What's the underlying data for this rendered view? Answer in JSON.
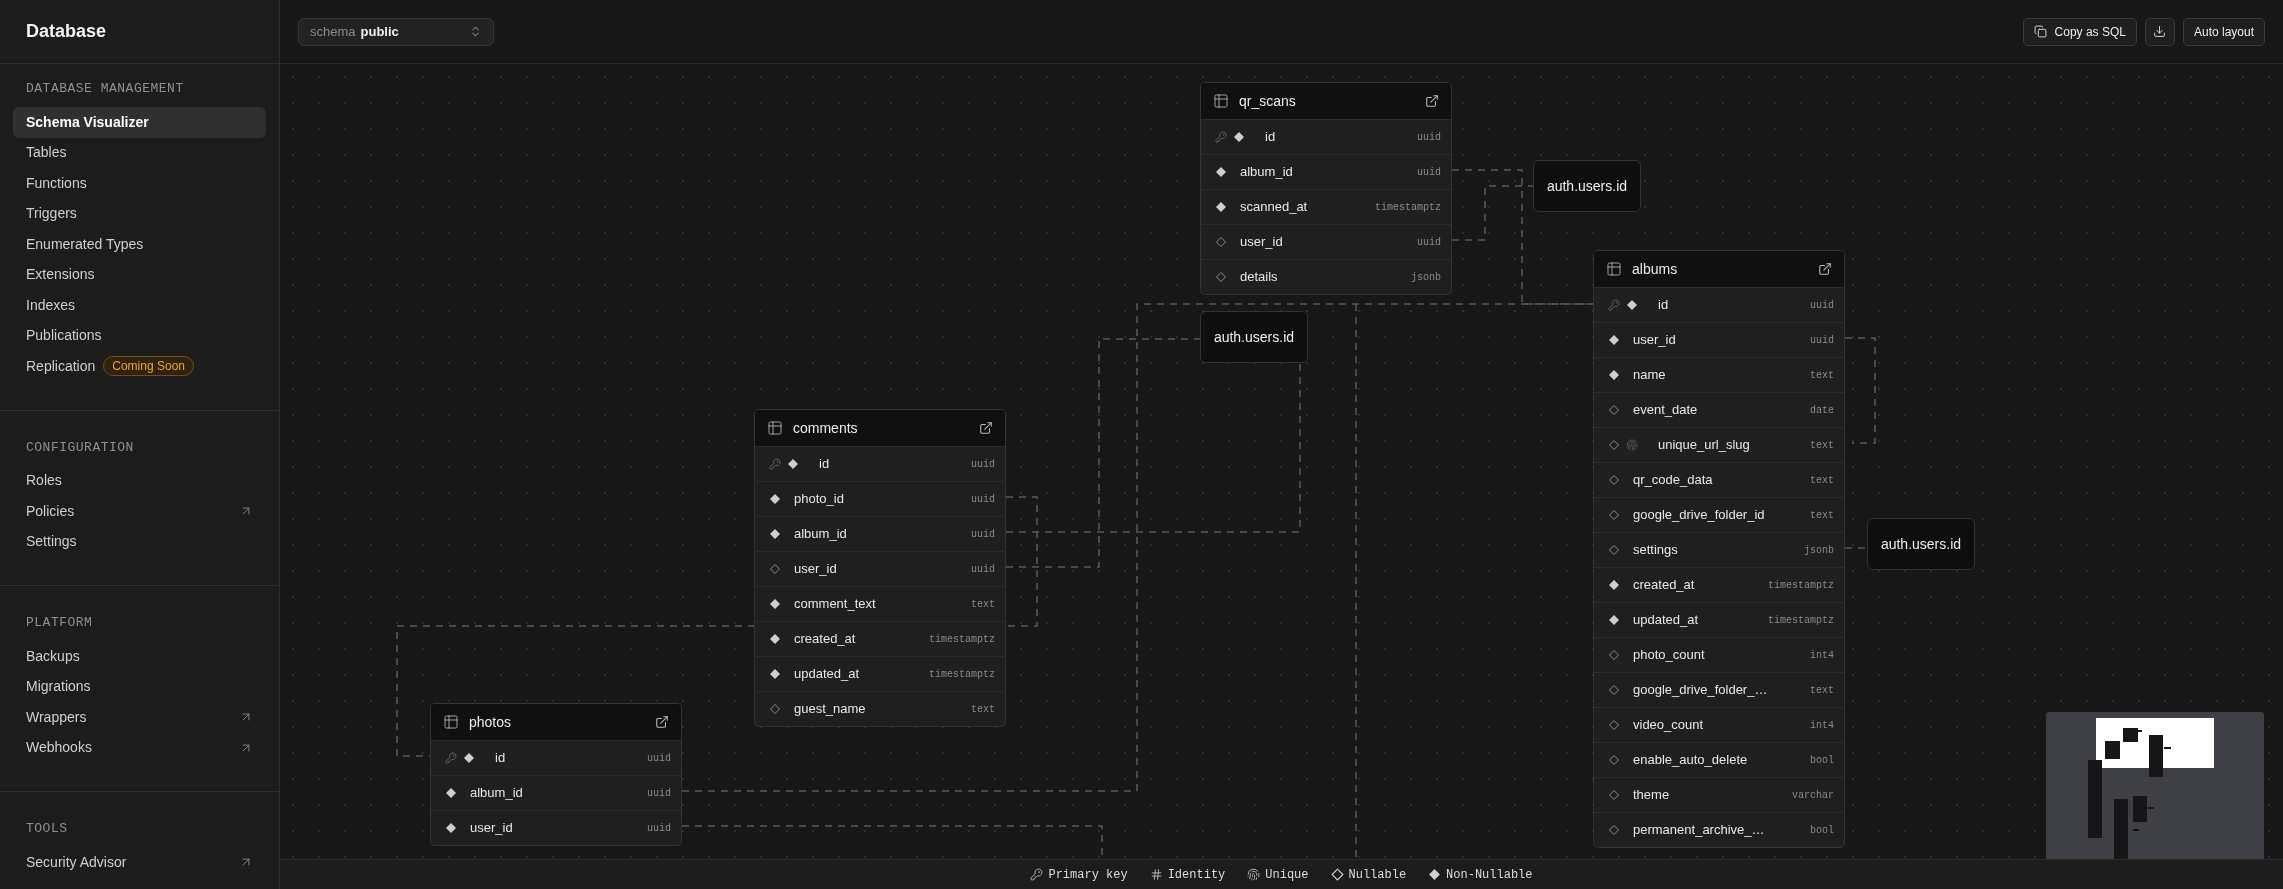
{
  "sidebar": {
    "title": "Database",
    "sections": [
      {
        "heading": "DATABASE MANAGEMENT",
        "items": [
          {
            "label": "Schema Visualizer",
            "selected": true,
            "external": false
          },
          {
            "label": "Tables",
            "selected": false,
            "external": false
          },
          {
            "label": "Functions",
            "selected": false,
            "external": false
          },
          {
            "label": "Triggers",
            "selected": false,
            "external": false
          },
          {
            "label": "Enumerated Types",
            "selected": false,
            "external": false
          },
          {
            "label": "Extensions",
            "selected": false,
            "external": false
          },
          {
            "label": "Indexes",
            "selected": false,
            "external": false
          },
          {
            "label": "Publications",
            "selected": false,
            "external": false
          },
          {
            "label": "Replication",
            "selected": false,
            "external": false,
            "badge": "Coming Soon"
          }
        ]
      },
      {
        "heading": "CONFIGURATION",
        "items": [
          {
            "label": "Roles",
            "selected": false,
            "external": false
          },
          {
            "label": "Policies",
            "selected": false,
            "external": true
          },
          {
            "label": "Settings",
            "selected": false,
            "external": false
          }
        ]
      },
      {
        "heading": "PLATFORM",
        "items": [
          {
            "label": "Backups",
            "selected": false,
            "external": false
          },
          {
            "label": "Migrations",
            "selected": false,
            "external": false
          },
          {
            "label": "Wrappers",
            "selected": false,
            "external": true
          },
          {
            "label": "Webhooks",
            "selected": false,
            "external": true
          }
        ]
      },
      {
        "heading": "TOOLS",
        "items": [
          {
            "label": "Security Advisor",
            "selected": false,
            "external": true
          }
        ]
      }
    ]
  },
  "toolbar": {
    "schema_label": "schema",
    "schema_value": "public",
    "buttons": [
      {
        "kind": "copy",
        "label": "Copy as SQL"
      },
      {
        "kind": "download"
      },
      {
        "kind": "text",
        "label": "Auto layout"
      }
    ]
  },
  "tables": [
    {
      "name": "qr_scans",
      "columns": [
        {
          "name": "id",
          "type": "uuid",
          "primary": true,
          "nullable": false,
          "unique": false
        },
        {
          "name": "album_id",
          "type": "uuid",
          "primary": false,
          "nullable": false,
          "unique": false
        },
        {
          "name": "scanned_at",
          "type": "timestamptz",
          "primary": false,
          "nullable": false,
          "unique": false
        },
        {
          "name": "user_id",
          "type": "uuid",
          "primary": false,
          "nullable": true,
          "unique": false
        },
        {
          "name": "details",
          "type": "jsonb",
          "primary": false,
          "nullable": true,
          "unique": false
        }
      ]
    },
    {
      "name": "albums",
      "columns": [
        {
          "name": "id",
          "type": "uuid",
          "primary": true,
          "nullable": false,
          "unique": false
        },
        {
          "name": "user_id",
          "type": "uuid",
          "primary": false,
          "nullable": false,
          "unique": false
        },
        {
          "name": "name",
          "type": "text",
          "primary": false,
          "nullable": false,
          "unique": false
        },
        {
          "name": "event_date",
          "type": "date",
          "primary": false,
          "nullable": true,
          "unique": false
        },
        {
          "name": "unique_url_slug",
          "type": "text",
          "primary": false,
          "nullable": true,
          "unique": true
        },
        {
          "name": "qr_code_data",
          "type": "text",
          "primary": false,
          "nullable": true,
          "unique": false
        },
        {
          "name": "google_drive_folder_id",
          "type": "text",
          "primary": false,
          "nullable": true,
          "unique": false
        },
        {
          "name": "settings",
          "type": "jsonb",
          "primary": false,
          "nullable": true,
          "unique": false
        },
        {
          "name": "created_at",
          "type": "timestamptz",
          "primary": false,
          "nullable": false,
          "unique": false
        },
        {
          "name": "updated_at",
          "type": "timestamptz",
          "primary": false,
          "nullable": false,
          "unique": false
        },
        {
          "name": "photo_count",
          "type": "int4",
          "primary": false,
          "nullable": true,
          "unique": false
        },
        {
          "name": "google_drive_folder_…",
          "type": "text",
          "primary": false,
          "nullable": true,
          "unique": false
        },
        {
          "name": "video_count",
          "type": "int4",
          "primary": false,
          "nullable": true,
          "unique": false
        },
        {
          "name": "enable_auto_delete",
          "type": "bool",
          "primary": false,
          "nullable": true,
          "unique": false
        },
        {
          "name": "theme",
          "type": "varchar",
          "primary": false,
          "nullable": true,
          "unique": false
        },
        {
          "name": "permanent_archive_…",
          "type": "bool",
          "primary": false,
          "nullable": true,
          "unique": false
        }
      ]
    },
    {
      "name": "comments",
      "columns": [
        {
          "name": "id",
          "type": "uuid",
          "primary": true,
          "nullable": false,
          "unique": false
        },
        {
          "name": "photo_id",
          "type": "uuid",
          "primary": false,
          "nullable": false,
          "unique": false
        },
        {
          "name": "album_id",
          "type": "uuid",
          "primary": false,
          "nullable": false,
          "unique": false
        },
        {
          "name": "user_id",
          "type": "uuid",
          "primary": false,
          "nullable": true,
          "unique": false
        },
        {
          "name": "comment_text",
          "type": "text",
          "primary": false,
          "nullable": false,
          "unique": false
        },
        {
          "name": "created_at",
          "type": "timestamptz",
          "primary": false,
          "nullable": false,
          "unique": false
        },
        {
          "name": "updated_at",
          "type": "timestamptz",
          "primary": false,
          "nullable": false,
          "unique": false
        },
        {
          "name": "guest_name",
          "type": "text",
          "primary": false,
          "nullable": true,
          "unique": false
        }
      ]
    },
    {
      "name": "photos",
      "columns": [
        {
          "name": "id",
          "type": "uuid",
          "primary": true,
          "nullable": false,
          "unique": false
        },
        {
          "name": "album_id",
          "type": "uuid",
          "primary": false,
          "nullable": false,
          "unique": false
        },
        {
          "name": "user_id",
          "type": "uuid",
          "primary": false,
          "nullable": false,
          "unique": false
        }
      ]
    }
  ],
  "references": [
    {
      "label": "auth.users.id"
    },
    {
      "label": "auth.users.id"
    },
    {
      "label": "auth.users.id"
    }
  ],
  "legend": [
    {
      "kind": "primary",
      "label": "Primary key"
    },
    {
      "kind": "identity",
      "label": "Identity"
    },
    {
      "kind": "unique",
      "label": "Unique"
    },
    {
      "kind": "nullable",
      "label": "Nullable"
    },
    {
      "kind": "notnull",
      "label": "Non-Nullable"
    }
  ]
}
